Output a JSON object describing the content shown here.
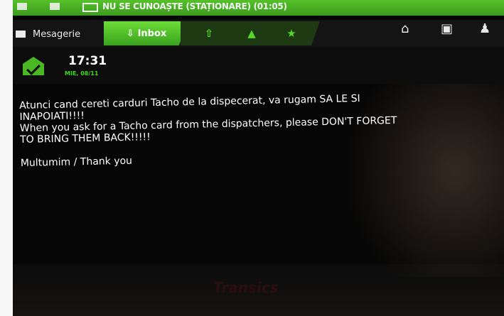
{
  "status_bar": {
    "text": "NU SE CUNOAȘTE (STAȚIONARE) (01:05)"
  },
  "tabs": {
    "mesagerie_label": "Mesagerie",
    "inbox_label": "Inbox",
    "inbox_icon": "⇩",
    "send_icon": "⇧",
    "contacts_icon": "▲",
    "favorites_icon": "★"
  },
  "actions": {
    "home_icon": "home-icon",
    "delete_icon": "trash-icon",
    "user_icon": "user-icon"
  },
  "message": {
    "time": "17:31",
    "date": "MIE, 08/11",
    "line1": "Atunci cand cereti carduri Tacho de la dispecerat, va rugam SA LE SI",
    "line2": "INAPOIATI!!!!",
    "line3": "When you ask for a Tacho card from the dispatchers, please DON'T FORGET",
    "line4": "TO BRING THEM BACK!!!!!",
    "line5": "Multumim / Thank you"
  },
  "brand": "Transics",
  "colors": {
    "accent": "#4cc027",
    "background": "#060606"
  }
}
